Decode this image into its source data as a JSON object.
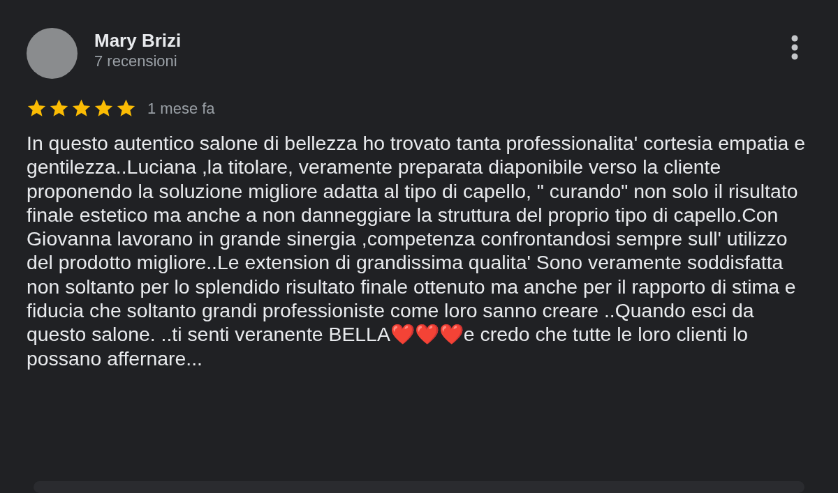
{
  "review": {
    "author": "Mary Brizi",
    "review_count": "7 recensioni",
    "stars": 5,
    "time": "1 mese fa",
    "text": "In questo autentico salone di bellezza ho trovato tanta professionalita' cortesia empatia e gentilezza..Luciana ,la titolare, veramente preparata diaponibile verso la cliente proponendo la soluzione migliore adatta al tipo di capello, \" curando\" non solo il risultato finale estetico ma anche a non danneggiare la struttura del proprio tipo di capello.Con Giovanna lavorano in grande sinergia ,competenza confrontandosi sempre sull' utilizzo del prodotto migliore..Le extension di grandissima qualita' Sono veramente soddisfatta non soltanto per lo splendido risultato finale ottenuto ma anche per il rapporto di stima e fiducia che soltanto grandi professioniste come loro sanno creare ..Quando esci da questo salone. ..ti senti veranente BELLA❤️❤️❤️e credo che tutte le loro clienti lo possano affernare..."
  }
}
